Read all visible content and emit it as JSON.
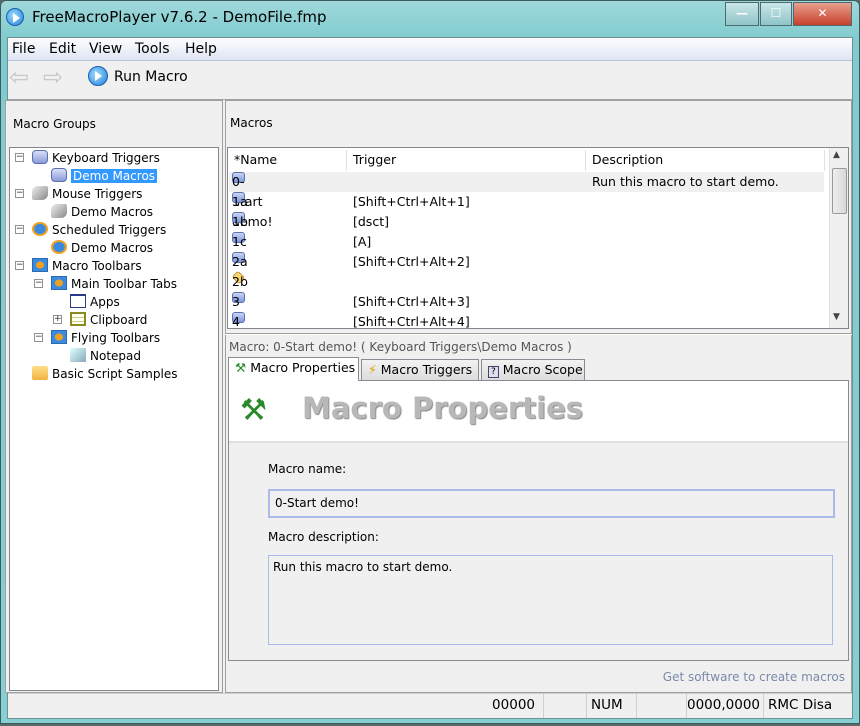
{
  "window": {
    "title": "FreeMacroPlayer v7.6.2 - DemoFile.fmp",
    "minimize": "—",
    "maximize": "☐",
    "close": "✕"
  },
  "menu": [
    "File",
    "Edit",
    "View",
    "Tools",
    "Help"
  ],
  "toolbar": {
    "back_icon": "back-arrow-icon",
    "forward_icon": "forward-arrow-icon",
    "run_label": "Run Macro"
  },
  "groups": {
    "title": "Macro Groups",
    "tree": [
      {
        "label": "Keyboard Triggers",
        "icon": "keyboard-icon"
      },
      {
        "label": "Demo Macros",
        "icon": "keyboard-icon",
        "selected": true
      },
      {
        "label": "Mouse Triggers",
        "icon": "mouse-icon"
      },
      {
        "label": "Demo Macros",
        "icon": "mouse-icon"
      },
      {
        "label": "Scheduled Triggers",
        "icon": "alarm-clock-icon"
      },
      {
        "label": "Demo Macros",
        "icon": "alarm-clock-icon"
      },
      {
        "label": "Macro Toolbars",
        "icon": "toolbar-icon"
      },
      {
        "label": "Main Toolbar Tabs",
        "icon": "toolbar-icon"
      },
      {
        "label": "Apps",
        "icon": "window-icon"
      },
      {
        "label": "Clipboard",
        "icon": "clipboard-icon"
      },
      {
        "label": "Flying Toolbars",
        "icon": "toolbar-icon"
      },
      {
        "label": "Notepad",
        "icon": "notepad-icon"
      },
      {
        "label": "Basic Script Samples",
        "icon": "folder-icon"
      }
    ]
  },
  "macros": {
    "title": "Macros",
    "columns": [
      "*Name",
      "Trigger",
      "Description"
    ],
    "rows": [
      {
        "name": "0-Start demo!",
        "trigger": "",
        "description": "Run this macro to start demo."
      },
      {
        "name": "1a",
        "trigger": "[Shift+Ctrl+Alt+1]",
        "description": ""
      },
      {
        "name": "1b",
        "trigger": "[dsct]",
        "description": ""
      },
      {
        "name": "1c",
        "trigger": "[A]",
        "description": ""
      },
      {
        "name": "2a",
        "trigger": "[Shift+Ctrl+Alt+2]",
        "description": ""
      },
      {
        "name": "2b",
        "trigger": "",
        "description": ""
      },
      {
        "name": "3",
        "trigger": "[Shift+Ctrl+Alt+3]",
        "description": ""
      },
      {
        "name": "4",
        "trigger": "[Shift+Ctrl+Alt+4]",
        "description": ""
      }
    ]
  },
  "detail": {
    "caption": "Macro: 0-Start demo! ( Keyboard Triggers\\Demo Macros )",
    "tabs": [
      "Macro Properties",
      "Macro Triggers",
      "Macro Scope"
    ],
    "heading": "Macro Properties",
    "name_label": "Macro name:",
    "name_value": "0-Start demo!",
    "desc_label": "Macro description:",
    "desc_value": "Run this macro to start demo."
  },
  "link": "Get software to create macros",
  "statusbar": [
    "00000",
    "",
    "NUM",
    "",
    "0000,0000",
    "RMC Disa"
  ],
  "colors": {
    "selection": "#3399ff",
    "frame": "#86cfd2",
    "link": "#7a8aa8"
  }
}
